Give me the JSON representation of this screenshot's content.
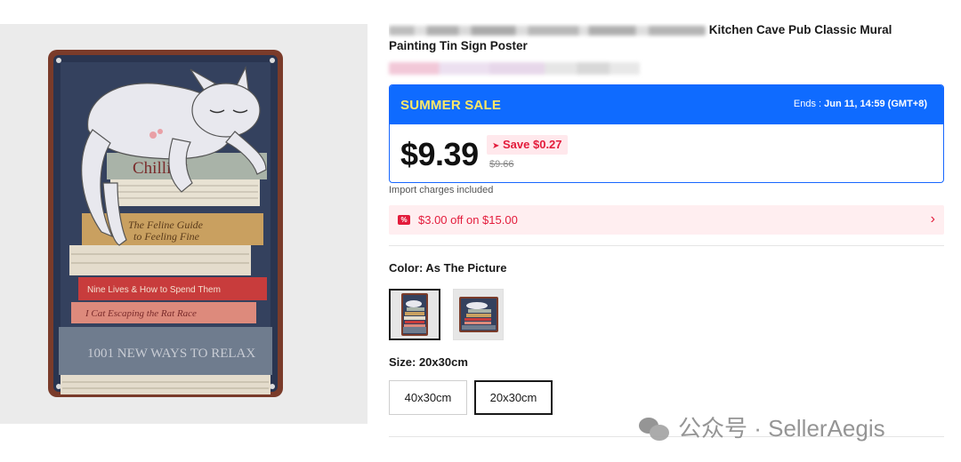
{
  "product": {
    "title_line1_visible": "Kitchen Cave Pub Classic Mural",
    "title_line2": "Painting Tin Sign Poster"
  },
  "sale": {
    "banner_title": "SUMMER SALE",
    "ends_label": "Ends :",
    "ends_value": "Jun 11, 14:59 (GMT+8)",
    "price": "$9.39",
    "save_label": "Save $0.27",
    "original_price": "$9.66"
  },
  "import_note": "Import charges included",
  "coupon": {
    "text": "$3.00 off on $15.00"
  },
  "color": {
    "label": "Color: As The Picture",
    "options": [
      "As The Picture",
      "As The Picture 2"
    ],
    "selected_index": 0
  },
  "size": {
    "label": "Size: 20x30cm",
    "options": [
      "40x30cm",
      "20x30cm"
    ],
    "selected_index": 1
  },
  "poster_text": {
    "book1": "Chilling",
    "book3a": "The Feline Guide",
    "book3b": "to Feeling Fine",
    "book5": "Nine Lives & How to Spend Them",
    "book6": "I Cat  Escaping the Rat Race",
    "book7": "1001 NEW WAYS TO RELAX"
  },
  "watermark": "公众号 · SellerAegis",
  "colors": {
    "accent_blue": "#0f6bff",
    "sale_yellow": "#ffe866",
    "discount_red": "#e31b3b"
  }
}
